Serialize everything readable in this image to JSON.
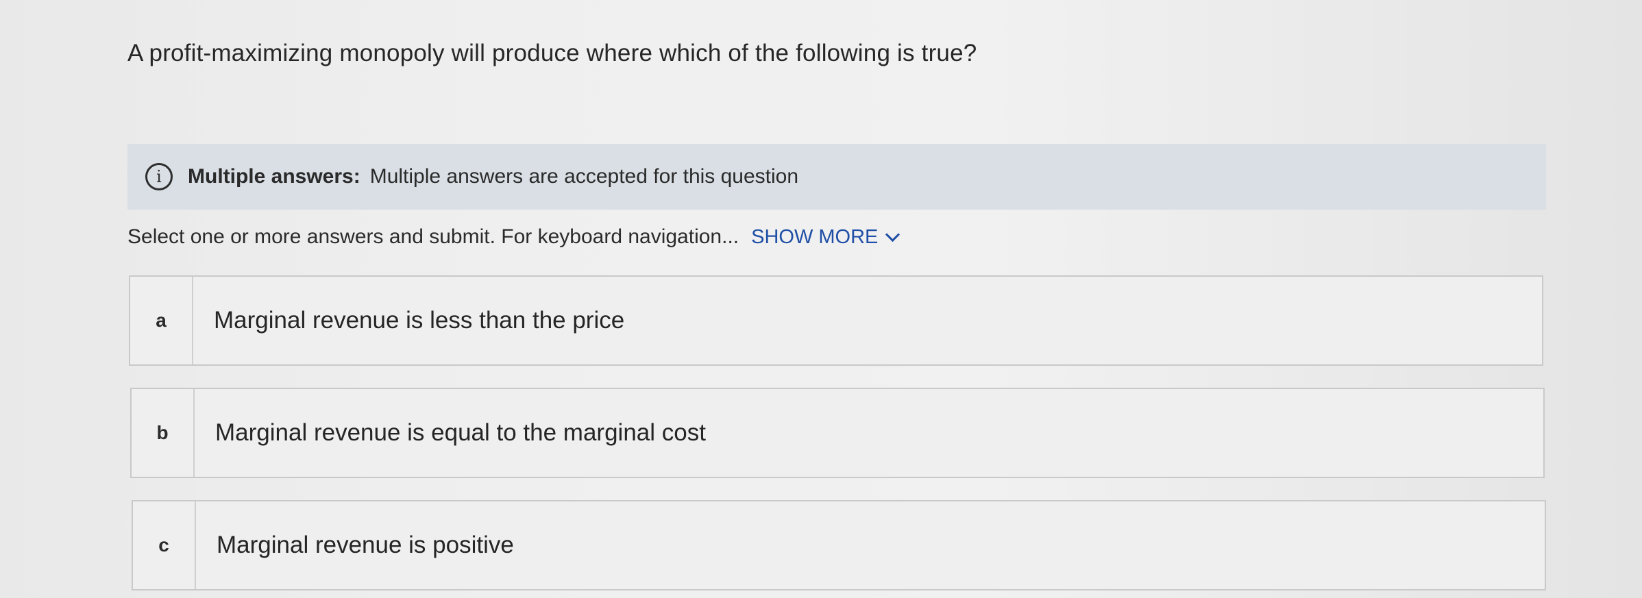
{
  "question": {
    "text": "A profit-maximizing monopoly will produce where which of the following is true?"
  },
  "info_banner": {
    "icon": "info-icon",
    "icon_glyph": "i",
    "label": "Multiple answers:",
    "text": "Multiple answers are accepted for this question"
  },
  "instructions": {
    "text": "Select one or more answers and submit. For keyboard navigation...",
    "show_more_label": "SHOW MORE",
    "show_more_icon": "chevron-down-icon",
    "link_color": "#1f4fa6"
  },
  "options": [
    {
      "letter": "a",
      "text": "Marginal revenue is less than the price"
    },
    {
      "letter": "b",
      "text": "Marginal revenue is equal to the marginal cost"
    },
    {
      "letter": "c",
      "text": "Marginal revenue is positive"
    }
  ],
  "colors": {
    "banner_background": "#d9dfe4",
    "option_border": "#c9c9c9"
  }
}
